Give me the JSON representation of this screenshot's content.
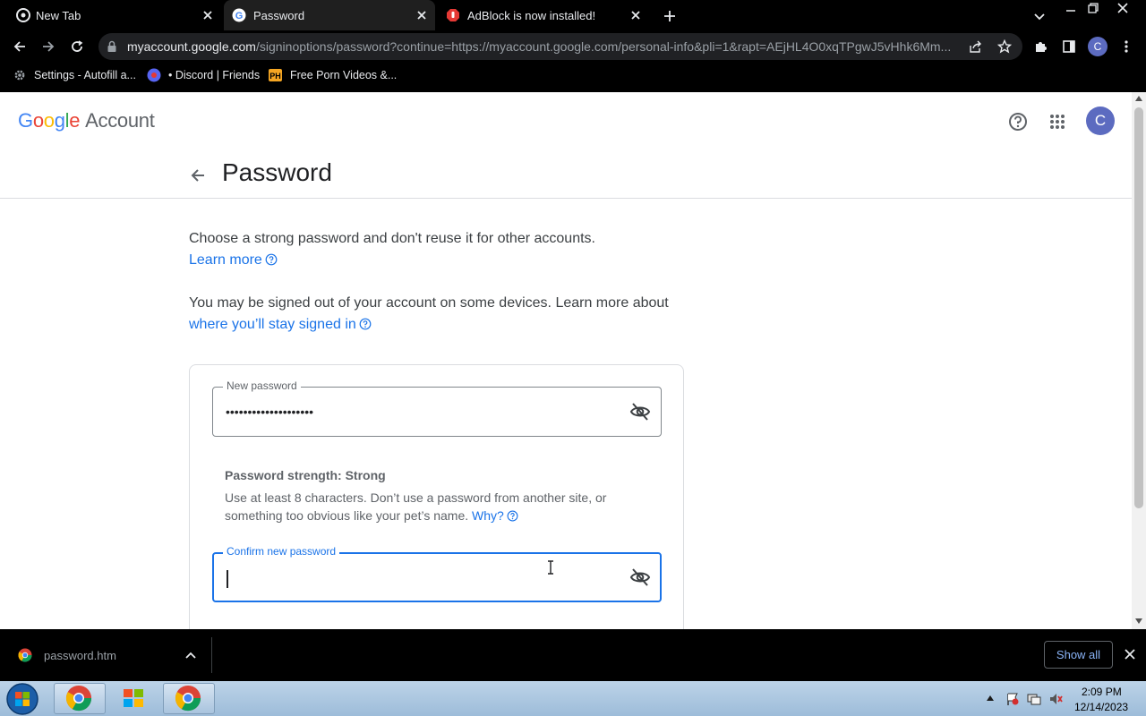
{
  "browser": {
    "tabs": [
      {
        "title": "New Tab"
      },
      {
        "title": "Password"
      },
      {
        "title": "AdBlock is now installed!"
      }
    ],
    "url_host": "myaccount.google.com",
    "url_path": "/signinoptions/password?continue=https://myaccount.google.com/personal-info&pli=1&rapt=AEjHL4O0xqTPgwJ5vHhk6Mm...",
    "profile_initial": "C",
    "bookmarks": [
      {
        "label": "Settings - Autofill a..."
      },
      {
        "label": "• Discord | Friends"
      },
      {
        "label": "Free Porn Videos &..."
      }
    ]
  },
  "header": {
    "logo_letters": [
      "G",
      "o",
      "o",
      "g",
      "l",
      "e"
    ],
    "logo_suffix": "Account",
    "avatar_initial": "C"
  },
  "page": {
    "title": "Password",
    "intro": "Choose a strong password and don't reuse it for other accounts.",
    "learn_more": "Learn more",
    "signout_text": "You may be signed out of your account on some devices. Learn more about",
    "signout_link": "where you’ll stay signed in",
    "new_password_label": "New password",
    "new_password_value": "••••••••••••••••••••",
    "strength_label": "Password strength: Strong",
    "hint_line1": "Use at least 8 characters. Don’t use a password from another site, or",
    "hint_line2": "something too obvious like your pet’s name.",
    "why_link": "Why?",
    "confirm_label": "Confirm new password",
    "confirm_value": ""
  },
  "downloads": {
    "file": "password.htm",
    "show_all": "Show all"
  },
  "taskbar": {
    "time": "2:09 PM",
    "date": "12/14/2023"
  },
  "colors": {
    "link": "#1a73e8",
    "focus": "#1a73e8",
    "avatar": "#5c6bc0"
  }
}
